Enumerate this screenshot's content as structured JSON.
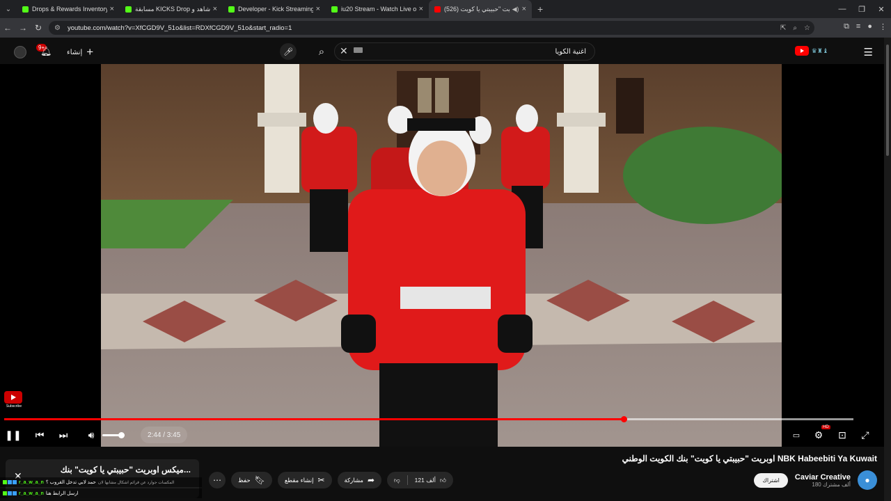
{
  "browser": {
    "tabs": [
      {
        "title": "Drops & Rewards Inventory - K",
        "favicon": "kick-icon",
        "active": false
      },
      {
        "title": "مسابقة KICKS Drop هنا، شاهد و",
        "favicon": "kick-icon",
        "active": false
      },
      {
        "title": "Developer - Kick Streaming",
        "favicon": "kick-icon",
        "active": false
      },
      {
        "title": "iu20 Stream - Watch Live on Ki",
        "favicon": "kick-icon",
        "active": false
      },
      {
        "title": "(526) اوبريت \"حبيبتي يا كويت",
        "favicon": "youtube-icon",
        "active": true
      }
    ],
    "url": "youtube.com/watch?v=XfCGD9V_51o&list=RDXfCGD9V_51o&start_radio=1"
  },
  "youtube": {
    "search_value": "اغنية الكويا",
    "create_label": "إنشاء",
    "notification_count": "9+"
  },
  "player": {
    "current_time": "2:44",
    "duration": "3:45",
    "time_display": "2:44 / 3:45",
    "progress_fraction": 0.7295,
    "buffered_fraction": 1.0,
    "volume_fraction": 0.85,
    "side_logo_label": "Subscribe"
  },
  "video_info": {
    "title": "اوبريت \"حبيبتي يا كويت\" بنك الكويت الوطني NBK Habeebiti Ya Kuwait",
    "channel_name": "Caviar Creative",
    "subscribers": "180 ألف مشترك",
    "subscribe_label": "اشتراك",
    "like_count": "121 ألف",
    "share_label": "مشاركة",
    "clip_label": "إنشاء مقطع",
    "save_label": "حفظ"
  },
  "miniplayer": {
    "title": "ميكس اوبريت \"حبيبتي يا كويت\" بنك..."
  },
  "chat": [
    {
      "user": "r_a_w_a_n",
      "message": "حمد لابي تدخل القروب ؟",
      "system": "المكسات جوارد عن قرائم اشكال مشابها لان"
    },
    {
      "user": "r_a_w_a_n",
      "message": "ارسل الرابط هنا"
    }
  ],
  "colors": {
    "accent": "#ff0000",
    "kick_green": "#53fc18",
    "background": "#0f0f0f"
  }
}
